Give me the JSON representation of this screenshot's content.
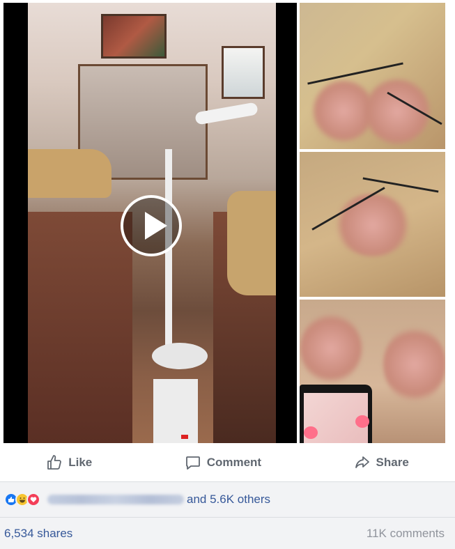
{
  "post": {
    "actions": {
      "like_label": "Like",
      "comment_label": "Comment",
      "share_label": "Share"
    },
    "reactions": {
      "types": [
        "like",
        "haha",
        "love"
      ],
      "others_text": "and 5.6K others"
    },
    "counts": {
      "shares_text": "6,534 shares",
      "comments_text": "11K comments"
    },
    "colors": {
      "link": "#365899",
      "muted": "#606770",
      "like_blue": "#1877f2",
      "haha_yellow": "#f7c531",
      "love_red": "#f33e58",
      "bar_bg": "#f2f3f5"
    }
  }
}
